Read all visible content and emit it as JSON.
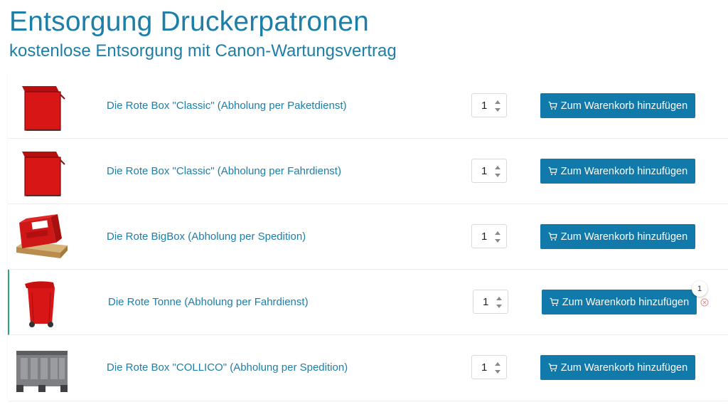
{
  "header": {
    "title": "Entsorgung Druckerpatronen",
    "subtitle": "kostenlose Entsorgung mit Canon-Wartungsvertrag"
  },
  "products": [
    {
      "name": "Die Rote Box \"Classic\" (Abholung per Paketdienst)",
      "quantity": "1",
      "button_label": "Zum Warenkorb hinzufügen",
      "image": "red-box-icon"
    },
    {
      "name": "Die Rote Box \"Classic\" (Abholung per Fahrdienst)",
      "quantity": "1",
      "button_label": "Zum Warenkorb hinzufügen",
      "image": "red-box-icon"
    },
    {
      "name": "Die Rote BigBox (Abholung per Spedition)",
      "quantity": "1",
      "button_label": "Zum Warenkorb hinzufügen",
      "image": "red-bigbox-pallet-icon"
    },
    {
      "name": "Die Rote Tonne (Abholung per Fahrdienst)",
      "quantity": "1",
      "button_label": "Zum Warenkorb hinzufügen",
      "image": "red-bin-icon",
      "cart_badge": "1"
    },
    {
      "name": "Die Rote Box \"COLLICO\" (Abholung per Spedition)",
      "quantity": "1",
      "button_label": "Zum Warenkorb hinzufügen",
      "image": "grey-collico-crate-icon"
    }
  ],
  "colors": {
    "accent": "#1d7ea8",
    "button": "#117aab",
    "active_row": "#2aa57a",
    "remove_icon": "#e38f8f"
  }
}
